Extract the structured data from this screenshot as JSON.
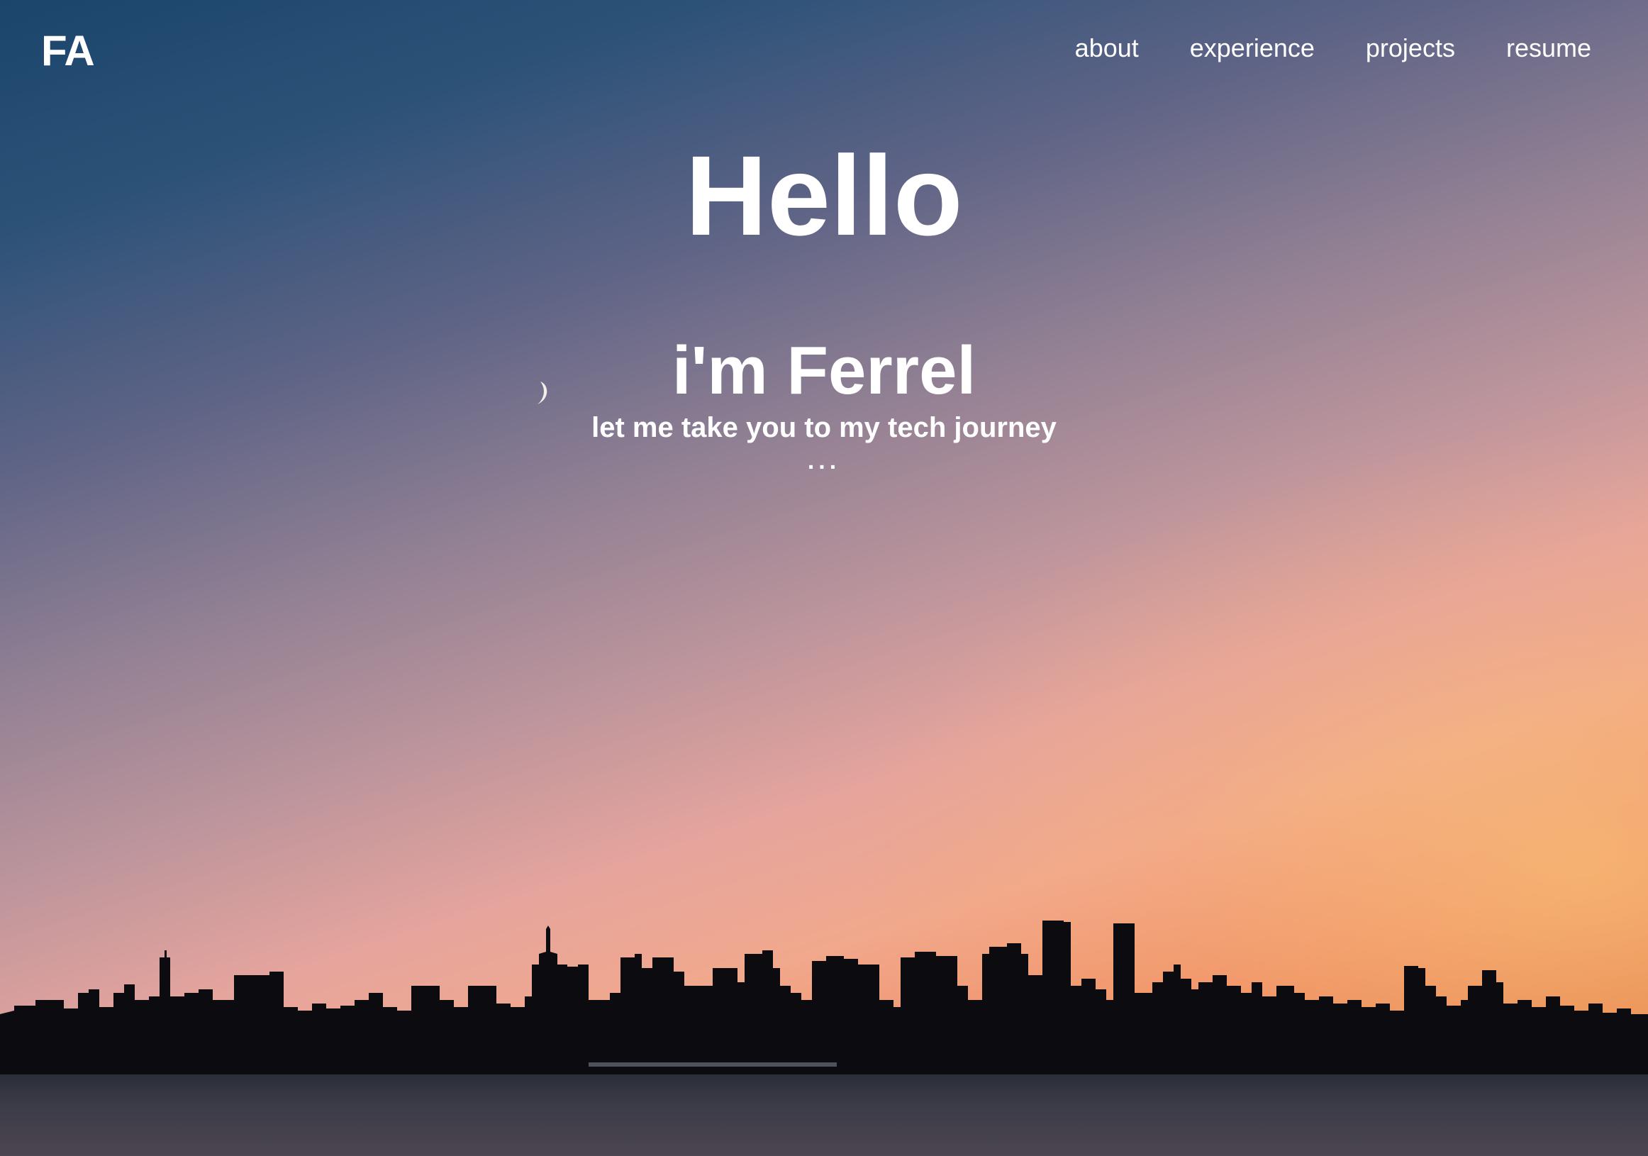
{
  "nav": {
    "logo": "FA",
    "links": [
      {
        "label": "about"
      },
      {
        "label": "experience"
      },
      {
        "label": "projects"
      },
      {
        "label": "resume"
      }
    ]
  },
  "hero": {
    "title": "Hello",
    "name": "i'm Ferrel",
    "tagline": "let me take you to my tech journey",
    "ellipsis": "..."
  },
  "background": {
    "description_icons": [
      "moon-icon",
      "city-skyline-image"
    ],
    "sky_top_color": "#1b456b",
    "sky_bottom_color": "#de6e3e"
  }
}
